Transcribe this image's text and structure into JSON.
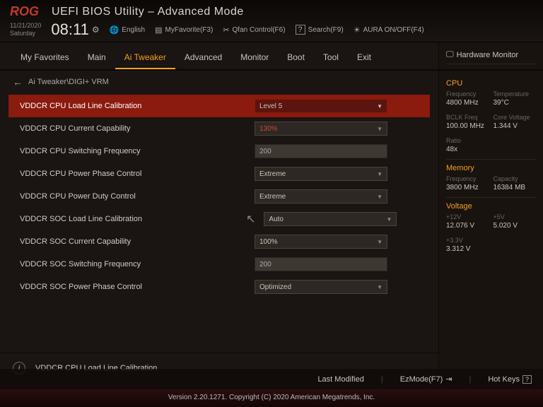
{
  "header": {
    "logo": "ROG",
    "title": "UEFI BIOS Utility – Advanced Mode",
    "date": "11/21/2020",
    "day": "Saturday",
    "time": "08:11",
    "links": {
      "lang": "English",
      "fav": "MyFavorite(F3)",
      "qfan": "Qfan Control(F6)",
      "search": "Search(F9)",
      "aura": "AURA ON/OFF(F4)"
    }
  },
  "tabs": [
    "My Favorites",
    "Main",
    "Ai Tweaker",
    "Advanced",
    "Monitor",
    "Boot",
    "Tool",
    "Exit"
  ],
  "activeTab": "Ai Tweaker",
  "breadcrumb": "Ai Tweaker\\DIGI+ VRM",
  "rows": [
    {
      "label": "VDDCR CPU Load Line Calibration",
      "type": "dropdown",
      "value": "Level 5",
      "selected": true
    },
    {
      "label": "VDDCR CPU Current Capability",
      "type": "dropdown",
      "value": "130%",
      "red": true
    },
    {
      "label": "VDDCR CPU Switching Frequency",
      "type": "text",
      "value": "200"
    },
    {
      "label": "VDDCR CPU Power Phase Control",
      "type": "dropdown",
      "value": "Extreme"
    },
    {
      "label": "VDDCR CPU Power Duty Control",
      "type": "dropdown",
      "value": "Extreme"
    },
    {
      "label": "VDDCR SOC Load Line Calibration",
      "type": "dropdown",
      "value": "Auto"
    },
    {
      "label": "VDDCR SOC Current Capability",
      "type": "dropdown",
      "value": "100%"
    },
    {
      "label": "VDDCR SOC Switching Frequency",
      "type": "text",
      "value": "200"
    },
    {
      "label": "VDDCR SOC Power Phase Control",
      "type": "dropdown",
      "value": "Optimized"
    }
  ],
  "help": "VDDCR CPU Load Line Calibration",
  "sidebar": {
    "title": "Hardware Monitor",
    "cpu": {
      "title": "CPU",
      "freqL": "Frequency",
      "freq": "4800 MHz",
      "tempL": "Temperature",
      "temp": "39°C",
      "bclkL": "BCLK Freq",
      "bclk": "100.00 MHz",
      "cvL": "Core Voltage",
      "cv": "1.344 V",
      "ratioL": "Ratio",
      "ratio": "48x"
    },
    "mem": {
      "title": "Memory",
      "freqL": "Frequency",
      "freq": "3800 MHz",
      "capL": "Capacity",
      "cap": "16384 MB"
    },
    "volt": {
      "title": "Voltage",
      "v12L": "+12V",
      "v12": "12.076 V",
      "v5L": "+5V",
      "v5": "5.020 V",
      "v3L": "+3.3V",
      "v3": "3.312 V"
    }
  },
  "footer": {
    "lastmod": "Last Modified",
    "ezmode": "EzMode(F7)",
    "hotkeys": "Hot Keys",
    "copy": "Version 2.20.1271. Copyright (C) 2020 American Megatrends, Inc."
  }
}
